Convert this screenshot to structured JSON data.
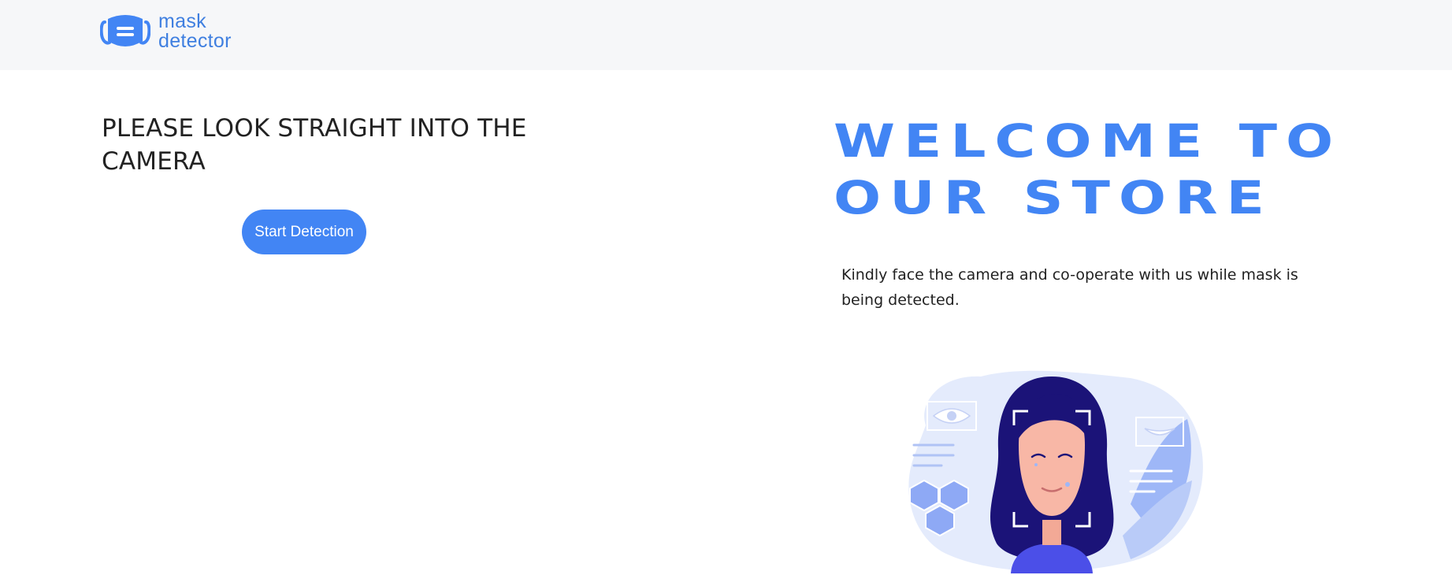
{
  "brand": {
    "line1": "mask",
    "line2": "detector",
    "icon": "face-mask-icon",
    "color": "#3f7fe0"
  },
  "left": {
    "title": "PLEASE LOOK STRAIGHT INTO THE CAMERA",
    "button_label": "Start Detection",
    "button_color": "#4285f4"
  },
  "right": {
    "welcome_line1": "WELCOME TO",
    "welcome_line2": "OUR STORE",
    "welcome_color": "#4285f4",
    "description": "Kindly face the camera and co-operate with us while mask is being detected.",
    "illustration_icon": "face-scan-illustration"
  }
}
